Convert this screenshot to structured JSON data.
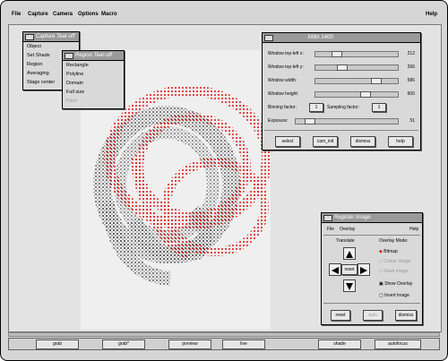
{
  "menubar": {
    "file": "File",
    "capture": "Capture",
    "camera": "Camera",
    "options": "Options",
    "macro": "Macro",
    "help": "Help"
  },
  "capture_tearoff": {
    "title": "Capture Tear-off",
    "items": [
      "Object",
      "Set Shade",
      "Region",
      "Averaging",
      "Stage center"
    ]
  },
  "region_tearoff": {
    "title": "Region Tear-off",
    "items": [
      "Rectangle",
      "Polyline",
      "Domain",
      "Full size",
      "Pixel"
    ]
  },
  "xmin_window": {
    "title": "XMin 1400",
    "rows": [
      {
        "label": "Window top-left x:",
        "value": "212"
      },
      {
        "label": "Window top-left y:",
        "value": "266"
      },
      {
        "label": "Window width:",
        "value": "586"
      },
      {
        "label": "Window height:",
        "value": "600"
      }
    ],
    "binning_label": "Binning factor:",
    "binning_value": "1",
    "sampling_label": "Sampling factor:",
    "sampling_value": "1",
    "exposure_label": "Exposure:",
    "exposure_value": "51",
    "buttons": [
      "select",
      "cam_init",
      "dismiss",
      "help"
    ]
  },
  "register_window": {
    "title": "Register Image",
    "menu": {
      "file": "File",
      "overlay": "Overlay",
      "help": "Help"
    },
    "translate_label": "Translate",
    "reset_center": "reset",
    "overlay_mode_label": "Overlay Mode:",
    "modes": [
      "Bitmap",
      "Colour Image",
      "Flash Image"
    ],
    "show_overlay": "Show Overlay",
    "invert_image": "Invert Image",
    "buttons": [
      "reset",
      "auto",
      "dismiss"
    ]
  },
  "dock": {
    "buttons": [
      "grab",
      "grab*",
      "preview",
      "live",
      "shade",
      "autofocus"
    ]
  }
}
